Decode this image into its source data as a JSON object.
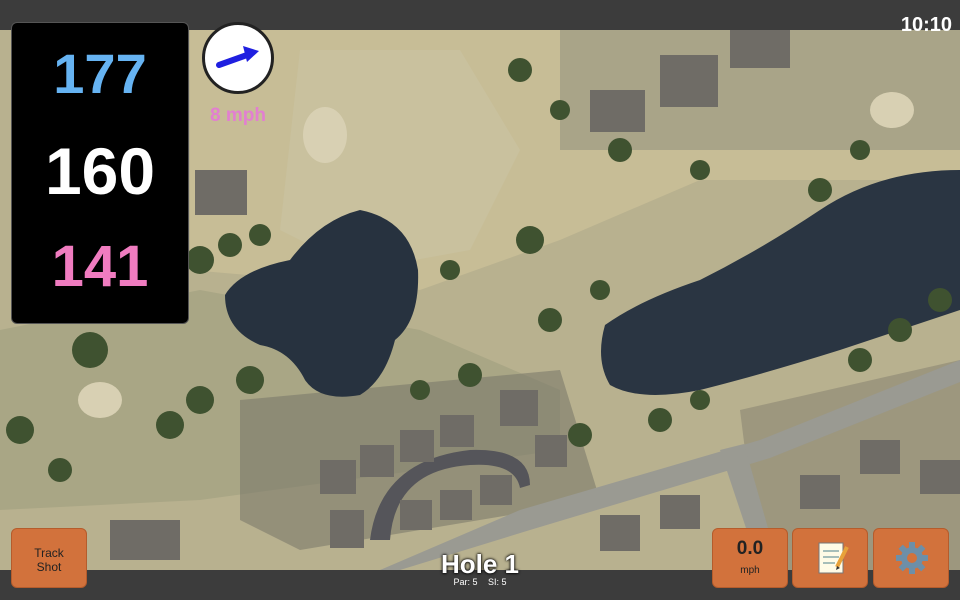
{
  "status": {
    "time": "10:10"
  },
  "distances": {
    "back": "177",
    "middle": "160",
    "front": "141",
    "colors": {
      "back": "#66b3f2",
      "middle": "#ffffff",
      "front": "#f07cc0"
    }
  },
  "wind": {
    "speed_label": "8 mph",
    "arrow_color": "#1f1fe0",
    "label_color": "#e27fd0"
  },
  "buttons": {
    "track_shot": "Track\nShot",
    "wind_value": "0.0",
    "wind_unit": "mph",
    "notes_icon": "notepad-icon",
    "settings_icon": "gear-icon",
    "accent": "#d2723c"
  },
  "hole": {
    "title": "Hole 1",
    "par": "Par: 5",
    "si": "SI: 5"
  }
}
